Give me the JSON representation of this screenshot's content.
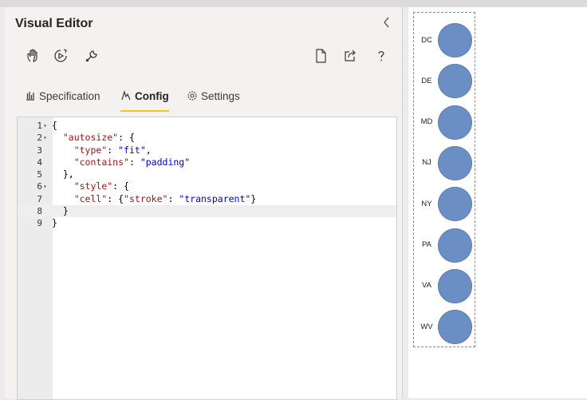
{
  "editor": {
    "title": "Visual Editor",
    "toolbar": [
      "hand-icon",
      "run-icon",
      "wrench-icon",
      "new-file-icon",
      "share-icon",
      "help-icon"
    ],
    "tabs": [
      {
        "label": "Specification",
        "icon": "bar-chart-icon",
        "active": false
      },
      {
        "label": "Config",
        "icon": "config-icon",
        "active": true
      },
      {
        "label": "Settings",
        "icon": "gear-icon",
        "active": false
      }
    ]
  },
  "code": {
    "current_line": 8,
    "lines": [
      {
        "n": "1",
        "text": "{"
      },
      {
        "n": "2",
        "text": "  \"autosize\": {"
      },
      {
        "n": "3",
        "text": "    \"type\": \"fit\","
      },
      {
        "n": "4",
        "text": "    \"contains\": \"padding\""
      },
      {
        "n": "5",
        "text": "  },"
      },
      {
        "n": "6",
        "text": "    \"style\": {"
      },
      {
        "n": "7",
        "text": "    \"cell\": {\"stroke\": \"transparent\"}"
      },
      {
        "n": "8",
        "text": "  }"
      },
      {
        "n": "9",
        "text": "}"
      }
    ]
  },
  "chart_data": {
    "type": "scatter",
    "categories": [
      "DC",
      "DE",
      "MD",
      "NJ",
      "NY",
      "PA",
      "VA",
      "WV"
    ],
    "mark": "circle",
    "color": "#6b8fc4"
  },
  "colors": {
    "accent": "#f2c811",
    "mark": "#6b8fc4"
  }
}
